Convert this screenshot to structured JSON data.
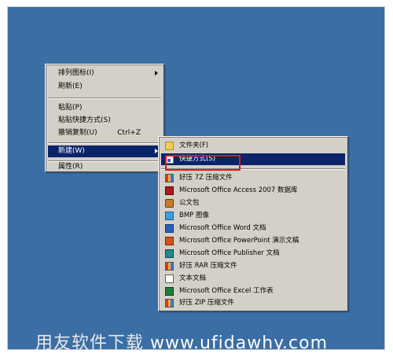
{
  "context_menu": {
    "items": [
      {
        "label": "排列图标(I)",
        "has_submenu": true
      },
      {
        "label": "刷新(E)"
      },
      {
        "label": "粘贴(P)"
      },
      {
        "label": "粘贴快捷方式(S)"
      },
      {
        "label": "撤销复制(U)",
        "shortcut": "Ctrl+Z"
      },
      {
        "label": "新建(W)",
        "has_submenu": true,
        "highlighted": true
      },
      {
        "label": "属性(R)"
      }
    ]
  },
  "new_submenu": {
    "items": [
      {
        "label": "文件夹(F)",
        "icon": "folder-icon"
      },
      {
        "label": "快捷方式(S)",
        "icon": "shortcut-icon",
        "highlighted": true
      },
      {
        "label": "好压 7Z 压缩文件",
        "icon": "archive-icon"
      },
      {
        "label": "Microsoft Office Access 2007 数据库",
        "icon": "access-icon"
      },
      {
        "label": "公文包",
        "icon": "briefcase-icon"
      },
      {
        "label": "BMP 图像",
        "icon": "bmp-image-icon"
      },
      {
        "label": "Microsoft Office Word 文档",
        "icon": "word-icon"
      },
      {
        "label": "Microsoft Office PowerPoint 演示文稿",
        "icon": "powerpoint-icon"
      },
      {
        "label": "Microsoft Office Publisher 文档",
        "icon": "publisher-icon"
      },
      {
        "label": "好压 RAR 压缩文件",
        "icon": "archive-icon"
      },
      {
        "label": "文本文档",
        "icon": "text-document-icon"
      },
      {
        "label": "Microsoft Office Excel 工作表",
        "icon": "excel-icon"
      },
      {
        "label": "好压 ZIP 压缩文件",
        "icon": "archive-icon"
      }
    ]
  },
  "watermark": {
    "brand": "用友软件下载",
    "url": "www.ufidawhy.com"
  },
  "colors": {
    "desktop": "#3a6ea5",
    "menu_bg": "#d4d0c8",
    "highlight": "#0a246a",
    "annotation_box": "#e01818"
  }
}
